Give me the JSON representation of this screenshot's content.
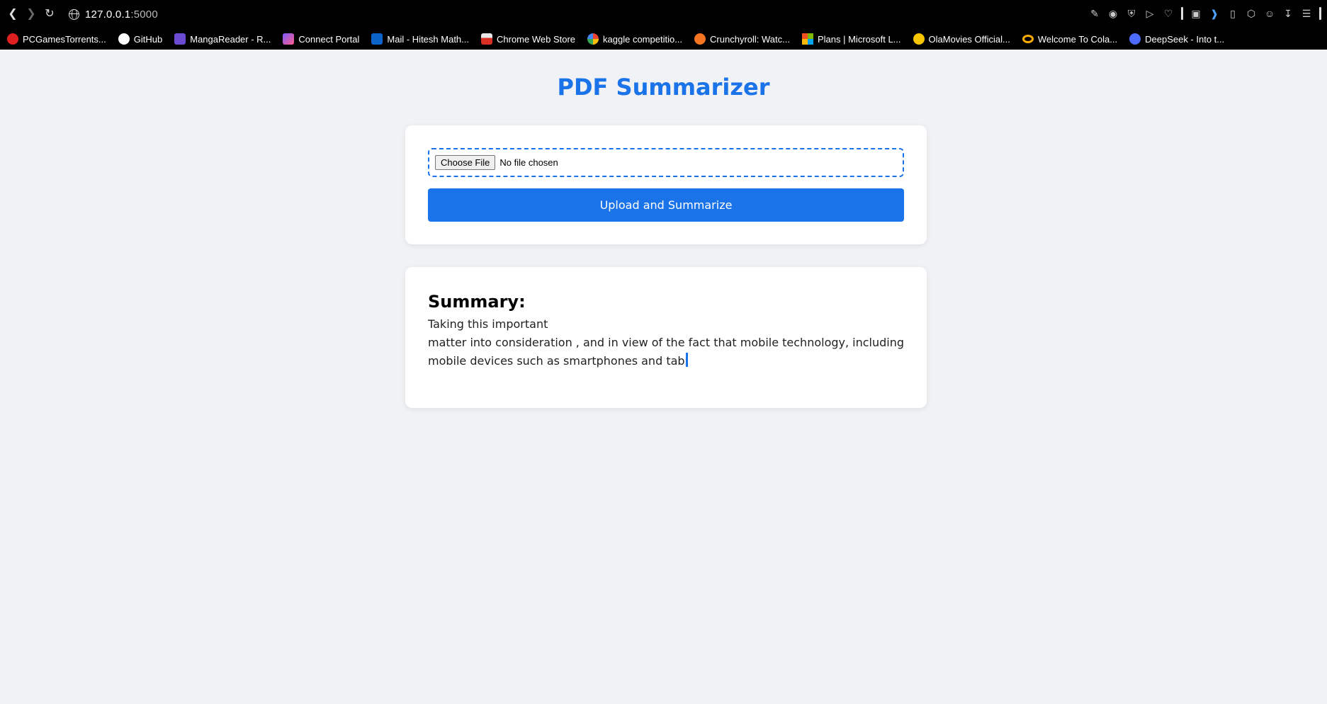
{
  "browser": {
    "url_host": "127.0.0.1",
    "url_port": ":5000",
    "bookmarks": [
      {
        "label": "PCGamesTorrents...",
        "icon": "pcgames-icon",
        "color": "#e02020"
      },
      {
        "label": "GitHub",
        "icon": "github-icon",
        "color": "#ffffff"
      },
      {
        "label": "MangaReader - R...",
        "icon": "mangareader-icon",
        "color": "#6a4bd1"
      },
      {
        "label": "Connect Portal",
        "icon": "connect-portal-icon",
        "color": "#7b5cff"
      },
      {
        "label": "Mail - Hitesh Math...",
        "icon": "outlook-icon",
        "color": "#0a64c9"
      },
      {
        "label": "Chrome Web Store",
        "icon": "chrome-web-store-icon",
        "color": "#e8e8e8"
      },
      {
        "label": "kaggle competitio...",
        "icon": "google-icon",
        "color": "#ffffff"
      },
      {
        "label": "Crunchyroll: Watc...",
        "icon": "crunchyroll-icon",
        "color": "#f47521"
      },
      {
        "label": "Plans | Microsoft L...",
        "icon": "microsoft-icon",
        "color": "#7fba00"
      },
      {
        "label": "OlaMovies Official...",
        "icon": "olamovies-icon",
        "color": "#f7c600"
      },
      {
        "label": "Welcome To Cola...",
        "icon": "colab-icon",
        "color": "#f9ab00"
      },
      {
        "label": "DeepSeek - Into t...",
        "icon": "deepseek-icon",
        "color": "#4d6bfe"
      }
    ]
  },
  "page": {
    "title": "PDF Summarizer"
  },
  "upload": {
    "choose_file_label": "Choose File",
    "file_status": "No file chosen",
    "submit_label": "Upload and Summarize"
  },
  "summary": {
    "heading": "Summary:",
    "lines": [
      "Taking this important",
      "matter into consideration , and in view of the fact that mobile technology, including",
      "mobile devices such as smartphones and tab"
    ]
  },
  "colors": {
    "accent": "#1a73e8",
    "background": "#f0f2f5"
  }
}
